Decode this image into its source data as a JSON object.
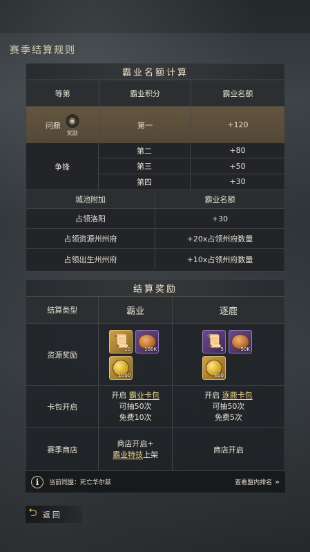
{
  "page": {
    "title": "赛季结算规则"
  },
  "panel_quota": {
    "title": "霸业名额计算",
    "headers": [
      "等第",
      "霸业积分",
      "霸业名额"
    ],
    "first": {
      "rank": "问鼎",
      "badge_label": "奖励",
      "score": "第一",
      "quota": "+120"
    },
    "group_label": "争锋",
    "group_rows": [
      {
        "score": "第二",
        "quota": "+80"
      },
      {
        "score": "第三",
        "quota": "+50"
      },
      {
        "score": "第四",
        "quota": "+30"
      }
    ],
    "city_headers": [
      "城池附加",
      "霸业名额"
    ],
    "city_rows": [
      {
        "name": "占领洛阳",
        "quota": "+30"
      },
      {
        "name": "占领资源州州府",
        "quota": "+20x占领州府数量"
      },
      {
        "name": "占领出生州州府",
        "quota": "+10x占领州府数量"
      }
    ]
  },
  "panel_reward": {
    "title": "结算奖励",
    "headers": [
      "结算类型",
      "霸业",
      "逐鹿"
    ],
    "resource_label": "资源奖励",
    "baye_items": [
      {
        "icon": "scroll-icon",
        "qty": "10",
        "style": "gold"
      },
      {
        "icon": "bread-icon",
        "qty": "100K",
        "style": "purple"
      },
      {
        "icon": "coin-icon",
        "qty": "1000",
        "style": "gold"
      }
    ],
    "zhulu_items": [
      {
        "icon": "scroll-icon",
        "qty": "5",
        "style": "purple"
      },
      {
        "icon": "bread-icon",
        "qty": "50K",
        "style": "purple"
      },
      {
        "icon": "coin-icon",
        "qty": "600",
        "style": "gold"
      }
    ],
    "pack_label": "卡包开启",
    "baye_pack": {
      "prefix": "开启 ",
      "link": "霸业卡包",
      "line2": "可抽50次",
      "line3": "免费10次"
    },
    "zhulu_pack": {
      "prefix": "开启 ",
      "link": "逐鹿卡包",
      "line2": "可抽50次",
      "line3": "免费5次"
    },
    "shop_label": "赛季商店",
    "baye_shop": {
      "line1": "商店开启+",
      "link": "霸业特技",
      "suffix": "上架"
    },
    "zhulu_shop": "商店开启"
  },
  "season_bar": {
    "league_text": "当前同盟：死亡华尔兹",
    "rank_link": "查看盟内排名"
  },
  "back_button": {
    "label": "返回"
  }
}
